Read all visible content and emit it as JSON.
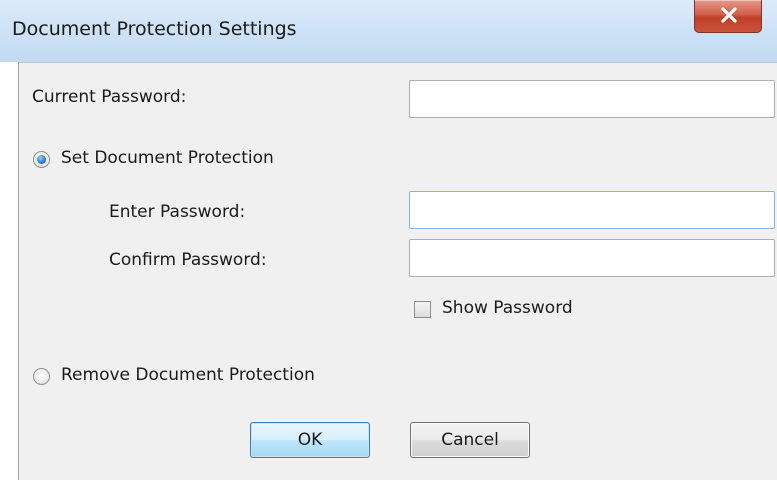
{
  "window": {
    "title": "Document Protection Settings"
  },
  "form": {
    "current_password_label": "Current Password:",
    "current_password_value": "",
    "set_protection_label": "Set Document Protection",
    "set_protection_selected": true,
    "enter_password_label": "Enter Password:",
    "enter_password_value": "",
    "confirm_password_label": "Confirm Password:",
    "confirm_password_value": "",
    "show_password_label": "Show Password",
    "show_password_checked": false,
    "remove_protection_label": "Remove Document Protection",
    "remove_protection_selected": false
  },
  "buttons": {
    "ok_label": "OK",
    "cancel_label": "Cancel"
  },
  "icons": {
    "close": "close-icon"
  }
}
